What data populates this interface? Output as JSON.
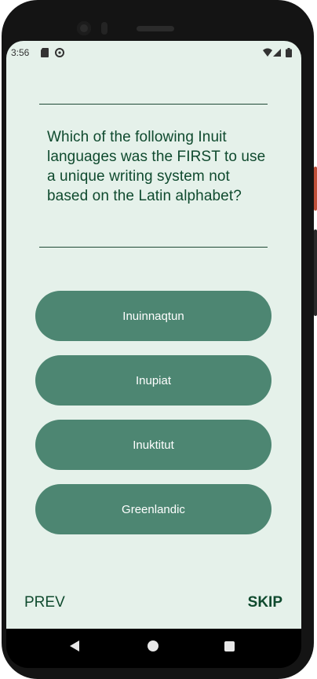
{
  "status_bar": {
    "time": "3:56",
    "left_icons": [
      "sd-card-icon",
      "vpn-key-icon"
    ],
    "right_icons": [
      "wifi-icon",
      "signal-icon",
      "battery-icon"
    ]
  },
  "quiz": {
    "question": "Which of the following Inuit languages was the FIRST to use a unique writing system not based on the Latin alphabet?",
    "answers": [
      "Inuinnaqtun",
      "Inupiat",
      "Inuktitut",
      "Greenlandic"
    ]
  },
  "navigation": {
    "prev_label": "PREV",
    "skip_label": "SKIP"
  },
  "system_nav": {
    "icons": [
      "back-icon",
      "home-icon",
      "recents-icon"
    ]
  },
  "colors": {
    "screen_background": "#e5f1ea",
    "button_fill": "#4d8672",
    "text_primary": "#0f4a2e"
  }
}
